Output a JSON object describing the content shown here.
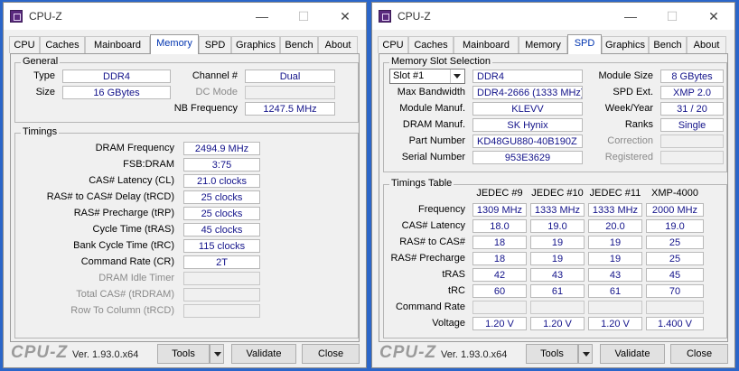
{
  "colors": {
    "desktop": "#2b66c9",
    "value_text": "#13138a",
    "active_tab": "#0034b0"
  },
  "windows": [
    {
      "title": "CPU-Z",
      "tabs": [
        "CPU",
        "Caches",
        "Mainboard",
        "Memory",
        "SPD",
        "Graphics",
        "Bench",
        "About"
      ],
      "active_tab": "Memory",
      "general": {
        "title": "General",
        "type_label": "Type",
        "type_value": "DDR4",
        "size_label": "Size",
        "size_value": "16 GBytes",
        "channel_label": "Channel #",
        "channel_value": "Dual",
        "dc_mode_label": "DC Mode",
        "dc_mode_value": "",
        "nb_freq_label": "NB Frequency",
        "nb_freq_value": "1247.5 MHz"
      },
      "timings": {
        "title": "Timings",
        "rows": [
          {
            "label": "DRAM Frequency",
            "value": "2494.9 MHz"
          },
          {
            "label": "FSB:DRAM",
            "value": "3:75"
          },
          {
            "label": "CAS# Latency (CL)",
            "value": "21.0 clocks"
          },
          {
            "label": "RAS# to CAS# Delay (tRCD)",
            "value": "25 clocks"
          },
          {
            "label": "RAS# Precharge (tRP)",
            "value": "25 clocks"
          },
          {
            "label": "Cycle Time (tRAS)",
            "value": "45 clocks"
          },
          {
            "label": "Bank Cycle Time (tRC)",
            "value": "115 clocks"
          },
          {
            "label": "Command Rate (CR)",
            "value": "2T"
          },
          {
            "label": "DRAM Idle Timer",
            "value": ""
          },
          {
            "label": "Total CAS# (tRDRAM)",
            "value": ""
          },
          {
            "label": "Row To Column (tRCD)",
            "value": ""
          }
        ]
      },
      "footer": {
        "logo": "CPU-Z",
        "version": "Ver. 1.93.0.x64",
        "tools_label": "Tools",
        "validate_label": "Validate",
        "close_label": "Close"
      }
    },
    {
      "title": "CPU-Z",
      "tabs": [
        "CPU",
        "Caches",
        "Mainboard",
        "Memory",
        "SPD",
        "Graphics",
        "Bench",
        "About"
      ],
      "active_tab": "SPD",
      "slot": {
        "title": "Memory Slot Selection",
        "selected_slot": "Slot #1",
        "type_value": "DDR4",
        "module_size_label": "Module Size",
        "module_size_value": "8 GBytes",
        "max_bw_label": "Max Bandwidth",
        "max_bw_value": "DDR4-2666 (1333 MHz)",
        "spd_ext_label": "SPD Ext.",
        "spd_ext_value": "XMP 2.0",
        "module_manuf_label": "Module Manuf.",
        "module_manuf_value": "KLEVV",
        "week_year_label": "Week/Year",
        "week_year_value": "31 / 20",
        "dram_manuf_label": "DRAM Manuf.",
        "dram_manuf_value": "SK Hynix",
        "ranks_label": "Ranks",
        "ranks_value": "Single",
        "part_label": "Part Number",
        "part_value": "KD48GU880-40B190Z",
        "correction_label": "Correction",
        "correction_value": "",
        "serial_label": "Serial Number",
        "serial_value": "953E3629",
        "registered_label": "Registered",
        "registered_value": ""
      },
      "timings_table": {
        "title": "Timings Table",
        "columns": [
          "JEDEC #9",
          "JEDEC #10",
          "JEDEC #11",
          "XMP-4000"
        ],
        "rows": [
          {
            "label": "Frequency",
            "values": [
              "1309 MHz",
              "1333 MHz",
              "1333 MHz",
              "2000 MHz"
            ]
          },
          {
            "label": "CAS# Latency",
            "values": [
              "18.0",
              "19.0",
              "20.0",
              "19.0"
            ]
          },
          {
            "label": "RAS# to CAS#",
            "values": [
              "18",
              "19",
              "19",
              "25"
            ]
          },
          {
            "label": "RAS# Precharge",
            "values": [
              "18",
              "19",
              "19",
              "25"
            ]
          },
          {
            "label": "tRAS",
            "values": [
              "42",
              "43",
              "43",
              "45"
            ]
          },
          {
            "label": "tRC",
            "values": [
              "60",
              "61",
              "61",
              "70"
            ]
          },
          {
            "label": "Command Rate",
            "values": [
              "",
              "",
              "",
              ""
            ]
          },
          {
            "label": "Voltage",
            "values": [
              "1.20 V",
              "1.20 V",
              "1.20 V",
              "1.400 V"
            ]
          }
        ]
      },
      "footer": {
        "logo": "CPU-Z",
        "version": "Ver. 1.93.0.x64",
        "tools_label": "Tools",
        "validate_label": "Validate",
        "close_label": "Close"
      }
    }
  ]
}
